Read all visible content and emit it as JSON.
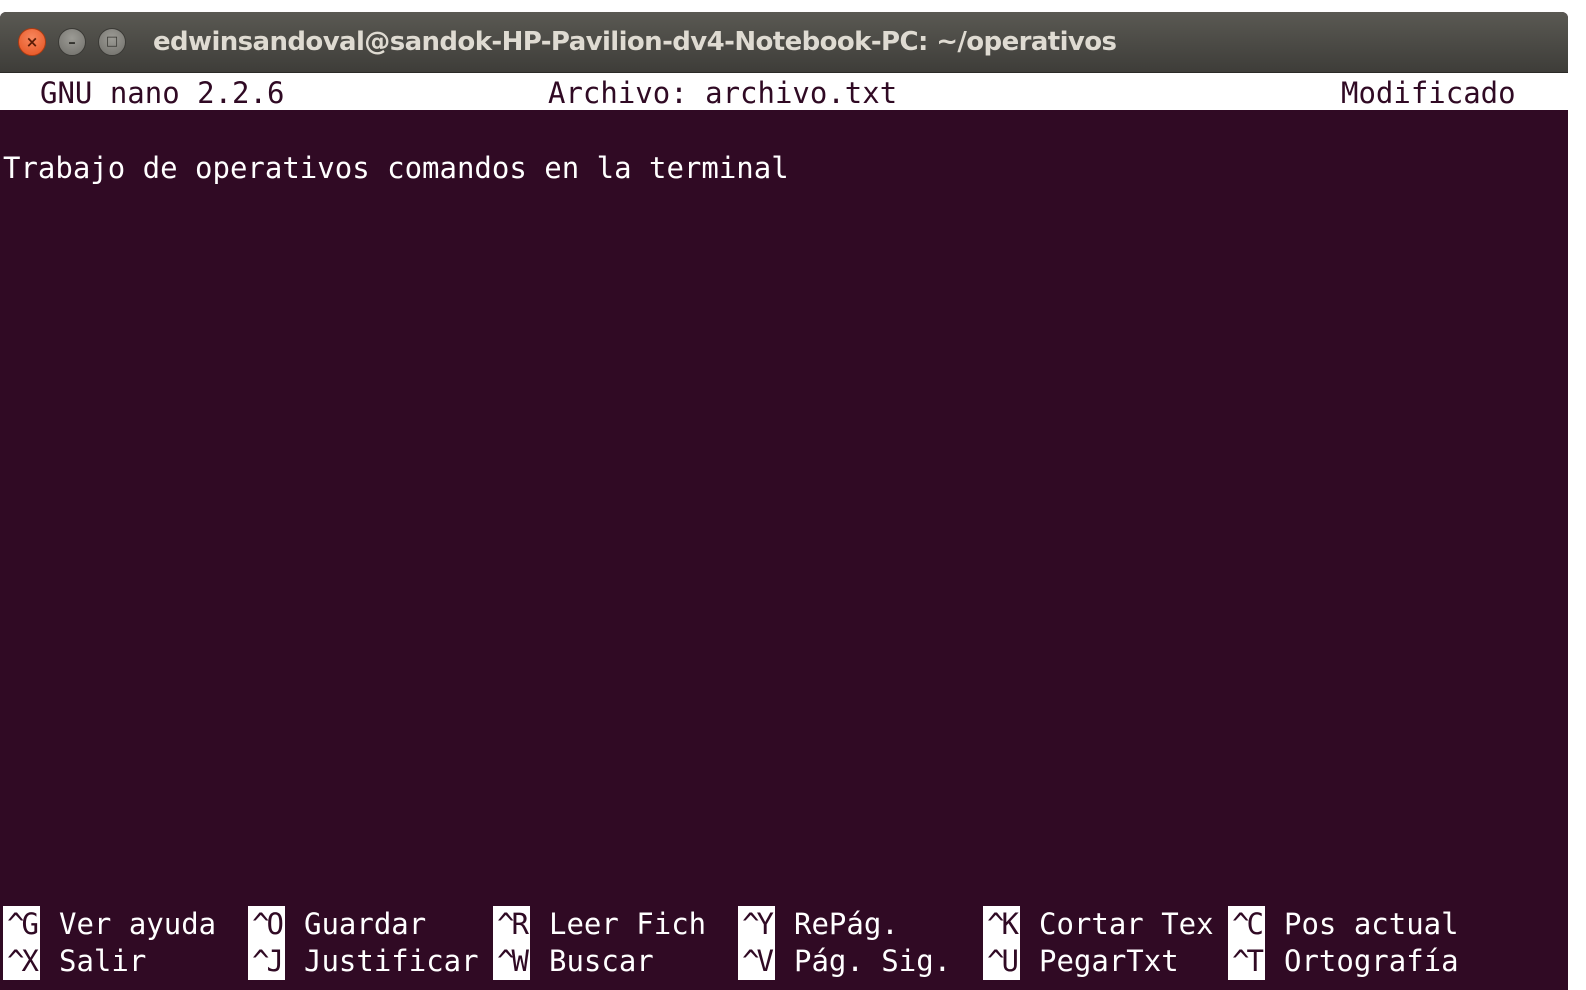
{
  "window": {
    "title": "edwinsandoval@sandok-HP-Pavilion-dv4-Notebook-PC: ~/operativos",
    "close_glyph": "×",
    "minimize_glyph": "–",
    "maximize_glyph": "□"
  },
  "nano": {
    "version": "GNU nano 2.2.6",
    "file": "Archivo: archivo.txt",
    "status": "Modificado"
  },
  "document": {
    "lines": [
      "Trabajo de operativos comandos en la terminal"
    ]
  },
  "shortcuts": {
    "row1": [
      {
        "key": "^G",
        "label": "Ver ayuda"
      },
      {
        "key": "^O",
        "label": "Guardar"
      },
      {
        "key": "^R",
        "label": "Leer Fich"
      },
      {
        "key": "^Y",
        "label": "RePág."
      },
      {
        "key": "^K",
        "label": "Cortar Tex"
      },
      {
        "key": "^C",
        "label": "Pos actual"
      }
    ],
    "row2": [
      {
        "key": "^X",
        "label": "Salir"
      },
      {
        "key": "^J",
        "label": "Justificar"
      },
      {
        "key": "^W",
        "label": "Buscar"
      },
      {
        "key": "^V",
        "label": "Pág. Sig."
      },
      {
        "key": "^U",
        "label": "PegarTxt"
      },
      {
        "key": "^T",
        "label": "Ortografía"
      }
    ]
  },
  "colors": {
    "terminal_background": "#300a24",
    "bar_background": "#ffffff",
    "text": "#ffffff",
    "close_button": "#e95420"
  }
}
